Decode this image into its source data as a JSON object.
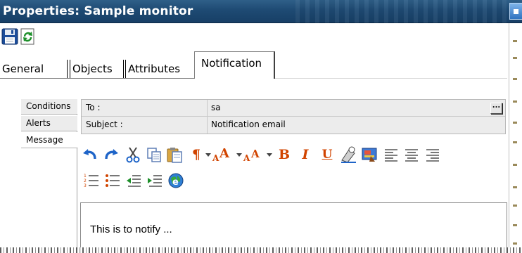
{
  "window": {
    "title": "Properties: Sample monitor"
  },
  "toolbar": {
    "save_icon": "save-icon",
    "refresh_icon": "refresh-icon"
  },
  "tabs": [
    {
      "label": "General",
      "selected": false
    },
    {
      "label": "Objects",
      "selected": false
    },
    {
      "label": "Attributes",
      "selected": false
    },
    {
      "label": "Notification",
      "selected": true
    }
  ],
  "side_tabs": [
    {
      "label": "Conditions",
      "selected": false
    },
    {
      "label": "Alerts",
      "selected": false
    },
    {
      "label": "Message",
      "selected": true
    }
  ],
  "form": {
    "to": {
      "label": "To :",
      "value": "sa",
      "button": "..."
    },
    "subject": {
      "label": "Subject :",
      "value": "Notification email"
    }
  },
  "editor_toolbar": {
    "paragraph": "¶",
    "font_size_up": "A",
    "font_size_down": "A",
    "bold": "B",
    "italic": "I",
    "underline": "U",
    "icons": [
      "undo-icon",
      "redo-icon",
      "cut-icon",
      "copy-icon",
      "paste-icon",
      "paragraph-icon",
      "font-size-increase-icon",
      "font-size-decrease-icon",
      "bold-icon",
      "italic-icon",
      "underline-icon",
      "clear-format-icon",
      "highlight-color-icon",
      "align-left-icon",
      "align-center-icon",
      "align-right-icon",
      "numbered-list-icon",
      "bullet-list-icon",
      "outdent-icon",
      "indent-icon",
      "insert-link-icon"
    ]
  },
  "editor": {
    "content": "This is to notify ..."
  },
  "colors": {
    "titlebar": "#1e4a73",
    "icon_accent": "#d14400",
    "selection_blue": "#1e64c8"
  }
}
